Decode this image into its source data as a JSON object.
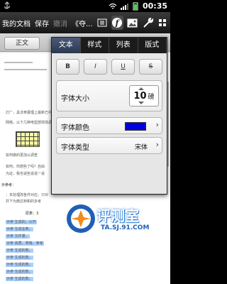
{
  "status_bar": {
    "time": "00:35"
  },
  "toolbar": {
    "my_docs": "我的文档",
    "save": "保存",
    "undo": "撤消",
    "redo_fragment": "《夺..."
  },
  "document": {
    "tab_label": "正文",
    "lines": [
      "灯厂，具法参展理上最新已中外参加",
      "网络，以下几种电型部现场调查",
      "如何做的更加以调查",
      "如何，你想些了吗？自由",
      "为这，我也说些说说一说",
      "示参考：",
      "：本处理改各件对应，只对",
      "并下为典达到和的多考",
      "原表：3",
      "示参 生成的，公开",
      "示参 生成业数，",
      "示参 文件量，",
      "示参 高质，表格，参考",
      "示参 生成的数，",
      "示参 生成的数，",
      "示参 生成的数，",
      "示参 生成的数，",
      "示参 生成的数，",
      "示参 生成的数，"
    ]
  },
  "format_panel": {
    "tabs": [
      {
        "label": "文本",
        "active": true
      },
      {
        "label": "样式",
        "active": false
      },
      {
        "label": "列表",
        "active": false
      },
      {
        "label": "版式",
        "active": false
      }
    ],
    "style_buttons": [
      "B",
      "I",
      "U",
      "S"
    ],
    "font_size_label": "字体大小",
    "font_size_value": "10",
    "font_size_unit": "磅",
    "font_color_label": "字体颜色",
    "font_color": "#0000dd",
    "font_type_label": "字体类型",
    "font_type_value": "宋体"
  },
  "watermark": {
    "text": "评测室",
    "subtext": "TA.SJ.91.COM"
  }
}
